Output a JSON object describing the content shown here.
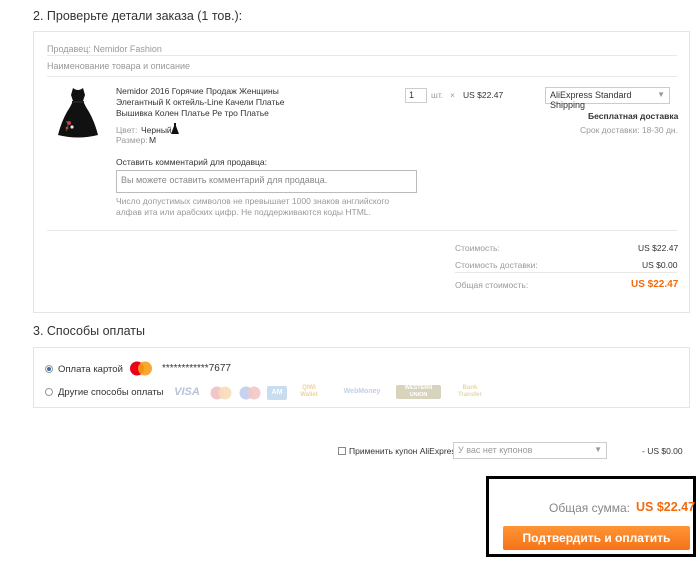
{
  "section2": {
    "title": "2. Проверьте детали заказа (1 тов.):",
    "seller_label": "Продавец: Nemidor Fashion",
    "col_header": "Наименование товара и описание",
    "product": {
      "title": "Nemidor 2016 Горячие Продаж Женщины Элегантный К октейль-Line Качели Платье Вышивка Колен Платье Ре тро Платье",
      "color_label": "Цвет:",
      "color_value": "Черный",
      "size_label": "Размер:",
      "size_value": "M",
      "quantity": "1",
      "unit": "шт.",
      "times": "×",
      "price": "US $22.47"
    },
    "shipping": {
      "method": "AliExpress Standard Shipping",
      "free_label": "Бесплатная доставка",
      "term": "Срок доставки: 18-30 дн."
    },
    "comment": {
      "label": "Оставить комментарий для продавца:",
      "placeholder": "Вы можете оставить комментарий для продавца.",
      "hint": "Число допустимых символов не превышает 1000 знаков английского алфав ита или арабских цифр. Не поддерживаются коды HTML."
    },
    "summary": {
      "cost_label": "Стоимость:",
      "cost_value": "US $22.47",
      "delivery_label": "Стоимость доставки:",
      "delivery_value": "US $0.00",
      "total_label": "Общая стоимость:",
      "total_value": "US $22.47"
    }
  },
  "section3": {
    "title": "3. Способы оплаты",
    "card_label": "Оплата картой",
    "card_number": "************7677",
    "other_label": "Другие способы оплаты",
    "logos": [
      "VISA",
      "MasterCard",
      "Maestro",
      "AMEX",
      "QIWI Wallet",
      "WebMoney",
      "WESTERN UNION",
      "Bank Transfer"
    ]
  },
  "coupon": {
    "label": "Применить купон AliExpress:",
    "select_value": "У вас нет купонов",
    "discount": "- US $0.00"
  },
  "footer": {
    "total_label": "Общая сумма:",
    "total_value": "US $22.47",
    "confirm_label": "Подтвердить и оплатить"
  },
  "colors": {
    "accent": "#f26b0d",
    "button": "#f57318",
    "mastercard_red": "#eb001b",
    "mastercard_yellow": "#f79e1b"
  }
}
